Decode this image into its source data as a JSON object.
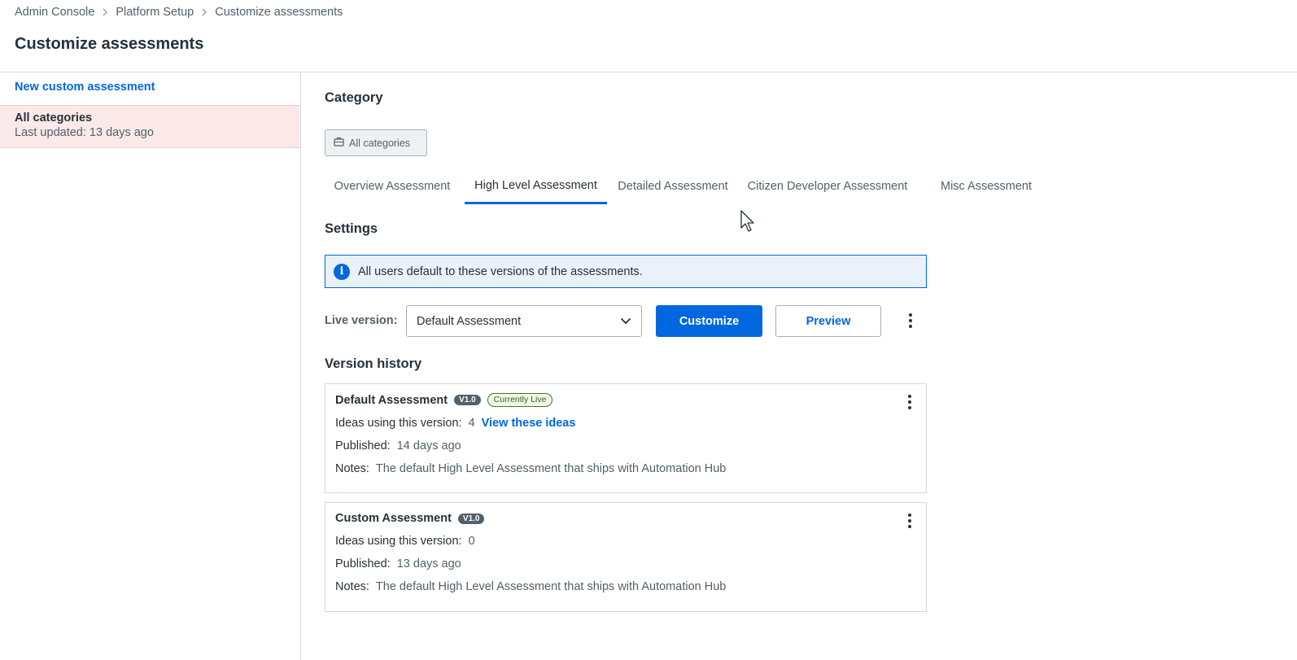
{
  "breadcrumb": [
    "Admin Console",
    "Platform Setup",
    "Customize assessments"
  ],
  "page_title": "Customize assessments",
  "sidebar": {
    "new_link": "New custom assessment",
    "items": [
      {
        "title": "All categories",
        "subtitle": "Last updated: 13 days ago"
      }
    ]
  },
  "main": {
    "category_heading": "Category",
    "category_chip": {
      "label": "All categories",
      "icon": "briefcase-icon"
    },
    "tabs": [
      {
        "label": "Overview Assessment",
        "active": false
      },
      {
        "label": "High Level Assessment",
        "active": true
      },
      {
        "label": "Detailed Assessment",
        "active": false
      },
      {
        "label": "Citizen Developer Assessment",
        "active": false
      },
      {
        "label": "Misc Assessment",
        "active": false
      }
    ],
    "settings_heading": "Settings",
    "info_text": "All users default to these versions of the assessments.",
    "live_version_label": "Live version:",
    "live_version_selected": "Default Assessment",
    "customize_label": "Customize",
    "preview_label": "Preview",
    "history_heading": "Version history",
    "versions": [
      {
        "name": "Default Assessment",
        "version": "V1.0",
        "status": "Currently Live",
        "ideas_label": "Ideas using this version:",
        "ideas_count": "4",
        "ideas_link": "View these ideas",
        "published_label": "Published:",
        "published": "14 days ago",
        "notes_label": "Notes:",
        "notes": "The default High Level Assessment that ships with Automation Hub"
      },
      {
        "name": "Custom Assessment",
        "version": "V1.0",
        "ideas_label": "Ideas using this version:",
        "ideas_count": "0",
        "published_label": "Published:",
        "published": "13 days ago",
        "notes_label": "Notes:",
        "notes": "The default High Level Assessment that ships with Automation Hub"
      }
    ]
  },
  "colors": {
    "accent": "#0067df",
    "selected_row": "#fbe9e9",
    "info_bg": "#e9f1fb",
    "text": "#273139",
    "muted": "#526069"
  }
}
